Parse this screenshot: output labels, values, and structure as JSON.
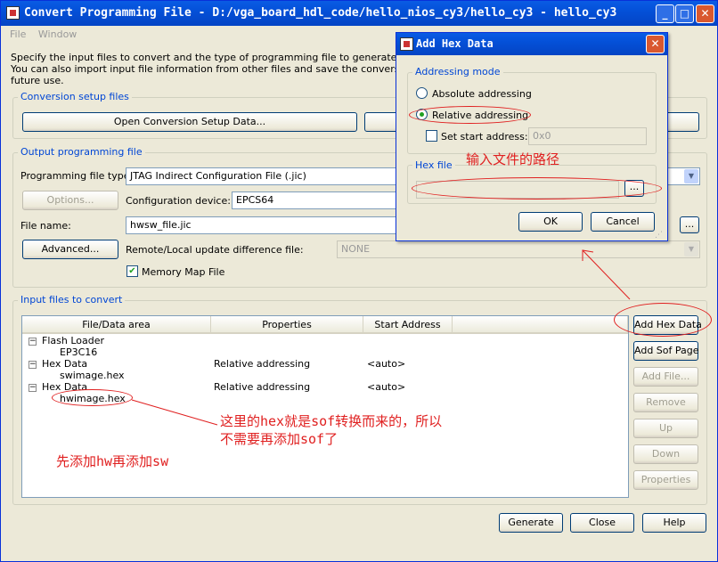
{
  "window": {
    "title": "Convert Programming File - D:/vga_board_hdl_code/hello_nios_cy3/hello_cy3 - hello_cy3"
  },
  "menu": {
    "file": "File",
    "window": "Window"
  },
  "intro": {
    "line1": "Specify the input files to convert and the type of programming file to generate.",
    "line2": "You can also import input file information from other files and save the conversion setup in",
    "line3": "future use."
  },
  "conversion_setup": {
    "group_title": "Conversion setup files",
    "open_button": "Open Conversion Setup Data..."
  },
  "output": {
    "group_title": "Output programming file",
    "type_label": "Programming file type:",
    "type_value": "JTAG Indirect Configuration File (.jic)",
    "options_button": "Options...",
    "device_label": "Configuration device:",
    "device_value": "EPCS64",
    "file_name_label": "File name:",
    "file_name_value": "hwsw_file.jic",
    "browse_button": "...",
    "advanced_button": "Advanced...",
    "remote_label": "Remote/Local update difference file:",
    "remote_value": "NONE",
    "memory_map_label": "Memory Map File"
  },
  "input": {
    "group_title": "Input files to convert",
    "columns": [
      "File/Data area",
      "Properties",
      "Start Address"
    ],
    "rows": [
      {
        "name": "Flash Loader",
        "props": "",
        "addr": ""
      },
      {
        "name": "EP3C16",
        "props": "",
        "addr": ""
      },
      {
        "name": "Hex Data",
        "props": "Relative addressing",
        "addr": "<auto>"
      },
      {
        "name": "swimage.hex",
        "props": "",
        "addr": ""
      },
      {
        "name": "Hex Data",
        "props": "Relative addressing",
        "addr": "<auto>"
      },
      {
        "name": "hwimage.hex",
        "props": "",
        "addr": ""
      }
    ]
  },
  "side_buttons": {
    "add_hex": "Add Hex Data",
    "add_sof": "Add Sof Page",
    "add_file": "Add File...",
    "remove": "Remove",
    "up": "Up",
    "down": "Down",
    "properties": "Properties"
  },
  "bottom_buttons": {
    "generate": "Generate",
    "close": "Close",
    "help": "Help"
  },
  "dialog": {
    "title": "Add Hex Data",
    "mode_title": "Addressing mode",
    "absolute": "Absolute addressing",
    "relative": "Relative addressing",
    "set_start": "Set start address:",
    "start_placeholder": "0x0",
    "hex_file_title": "Hex file",
    "browse": "...",
    "ok": "OK",
    "cancel": "Cancel"
  },
  "annotations": {
    "input_path": "输入文件的路径",
    "note_line1": "这里的hex就是sof转换而来的，所以",
    "note_line2": "不需要再添加sof了",
    "note_order": "先添加hw再添加sw"
  },
  "colors": {
    "accent": "#0046d5",
    "annotation": "#e02020",
    "titlebar": "#0450d8"
  }
}
